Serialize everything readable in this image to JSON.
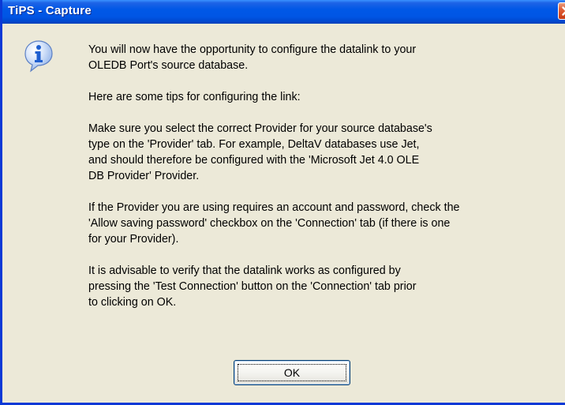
{
  "window": {
    "title": "TiPS - Capture"
  },
  "icons": {
    "message_icon": "info-icon",
    "close_icon": "close-icon"
  },
  "message": {
    "paragraphs": [
      "You will now have the opportunity to configure the datalink to your\nOLEDB Port's source database.",
      "Here are some tips for configuring the link:",
      "Make sure you select the correct Provider for your source database's\ntype on the 'Provider' tab.  For example, DeltaV databases use Jet,\nand should therefore be configured with the 'Microsoft Jet 4.0 OLE\nDB Provider' Provider.",
      "If the Provider you are using requires an account and password, check the\n'Allow saving password' checkbox on the 'Connection' tab (if there is one\nfor your Provider).",
      "It is advisable to verify that the datalink works as configured by\npressing the 'Test Connection' button on the 'Connection' tab prior\nto clicking on OK."
    ]
  },
  "buttons": {
    "ok_label": "OK"
  },
  "colors": {
    "titlebar": "#0055e5",
    "window_face": "#ece9d8",
    "close_button": "#d64a22",
    "info_icon": "#2f6fd6"
  }
}
